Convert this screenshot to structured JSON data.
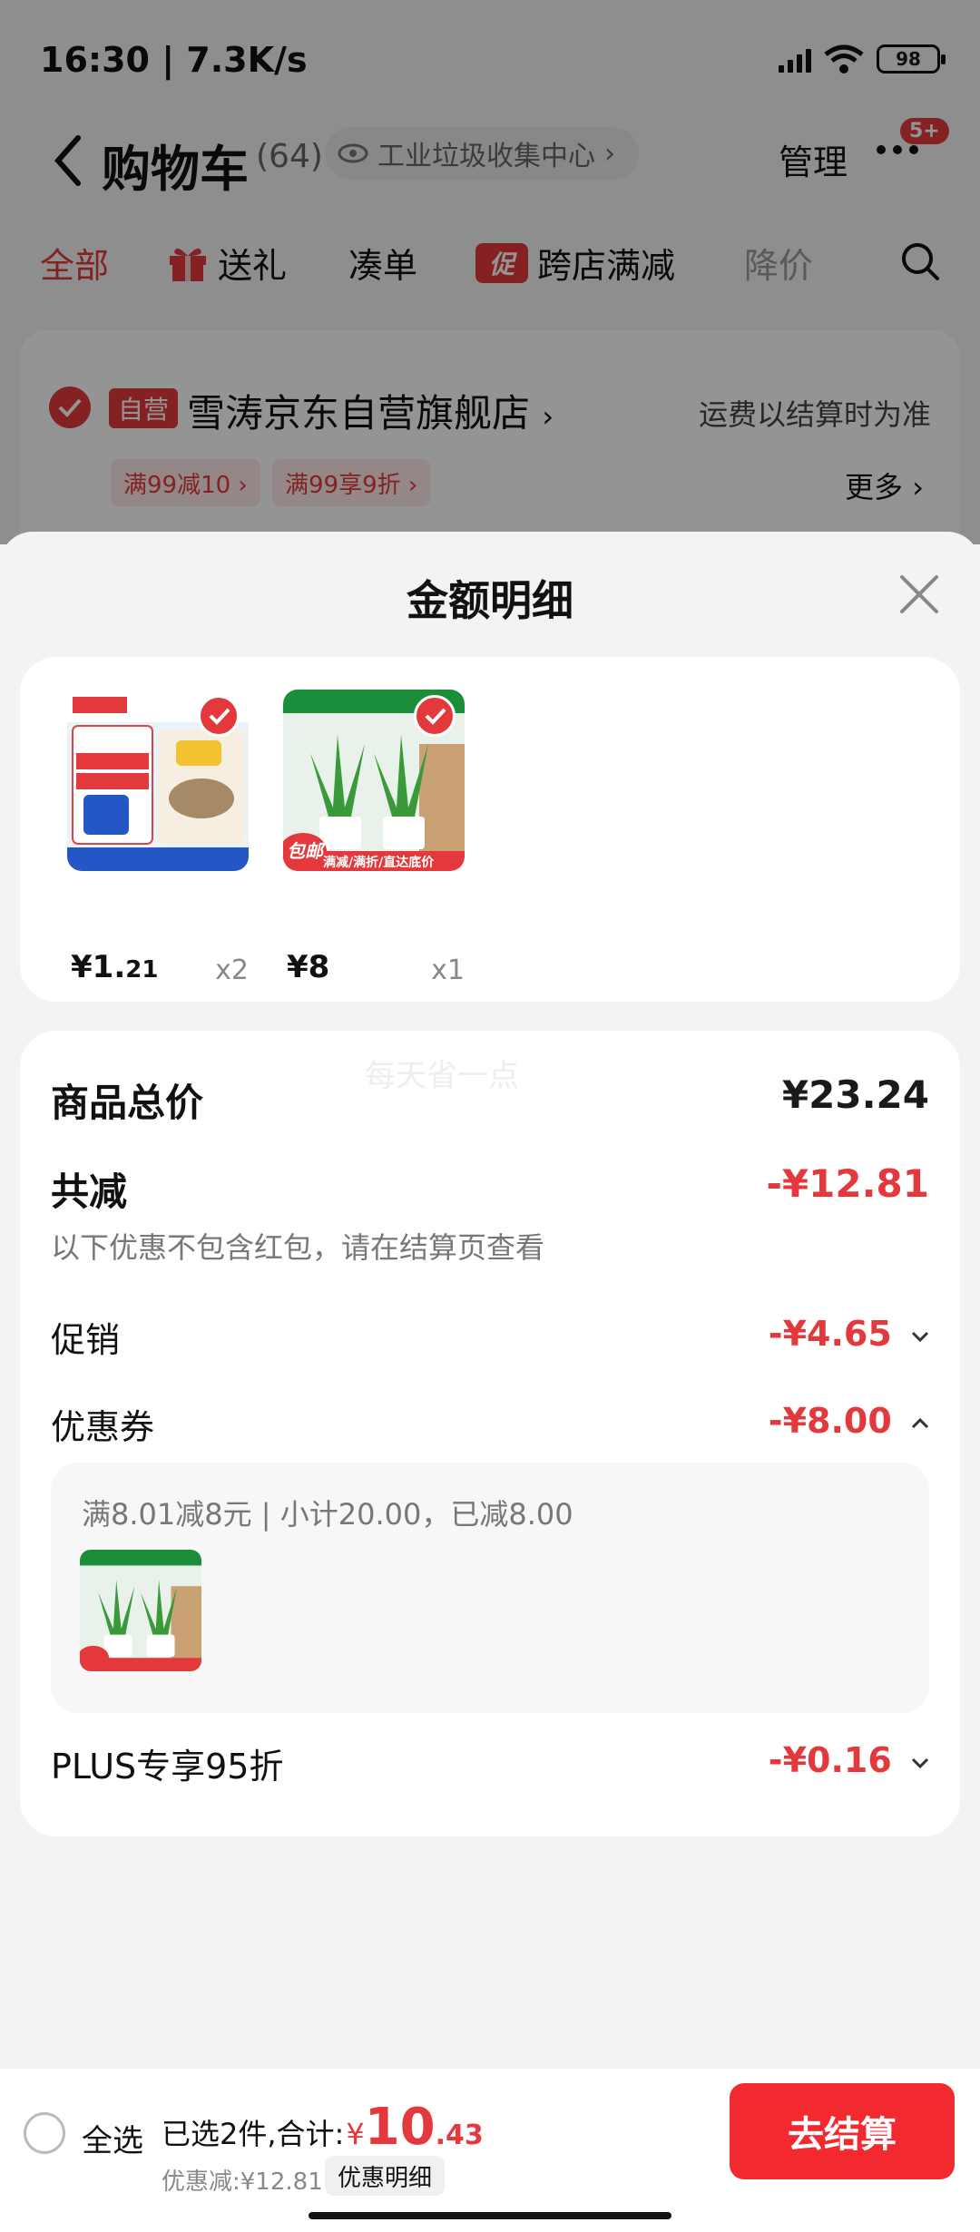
{
  "status_bar": {
    "time_speed": "16:30 | 7.3K/s",
    "battery": "98"
  },
  "header": {
    "title": "购物车",
    "count": "(64)",
    "address_tag": "工业垃圾收集中心",
    "manage_label": "管理",
    "notif_badge": "5+"
  },
  "tabs": [
    {
      "label": "全部"
    },
    {
      "label": "送礼"
    },
    {
      "label": "凑单"
    },
    {
      "promo_icon": "促",
      "label": "跨店满减"
    },
    {
      "label": "降价"
    }
  ],
  "store": {
    "self_tag": "自营",
    "name": "雪涛京东自营旗舰店",
    "shipping_note": "运费以结算时为准",
    "coupons": [
      "满99减10 ›",
      "满99享9折 ›"
    ],
    "more_label": "更多 ›"
  },
  "sheet": {
    "title": "金额明细",
    "watermark": "每天省一点",
    "products": [
      {
        "price_int": "¥1.",
        "price_dec": "21",
        "qty": "x2",
        "thumb": "salt-product-icon"
      },
      {
        "price_int": "¥8",
        "price_dec": "",
        "qty": "x1",
        "thumb": "aloe-plant-icon",
        "ribbon": "包邮",
        "banner": "满减/满折/直达底价"
      }
    ],
    "total_label": "商品总价",
    "total_value": "¥23.24",
    "reduce_label": "共减",
    "reduce_value": "-¥12.81",
    "reduce_note": "以下优惠不包含红包，请在结算页查看",
    "promo_label": "促销",
    "promo_value": "-¥4.65",
    "coupon_label": "优惠券",
    "coupon_value": "-¥8.00",
    "coupon_detail": "满8.01减8元 | 小计20.00，已减8.00",
    "plus_label": "PLUS专享95折",
    "plus_value": "-¥0.16"
  },
  "bottom_bar": {
    "select_all": "全选",
    "selected_prefix": "已选2件,合计:",
    "currency": "¥",
    "total_int": "10",
    "total_dec": ".43",
    "save_text": "优惠减:¥12.81",
    "detail_chip": "优惠明细",
    "checkout": "去结算"
  },
  "colors": {
    "accent": "#e4393c",
    "checkout_bg": "#f22a2f"
  }
}
